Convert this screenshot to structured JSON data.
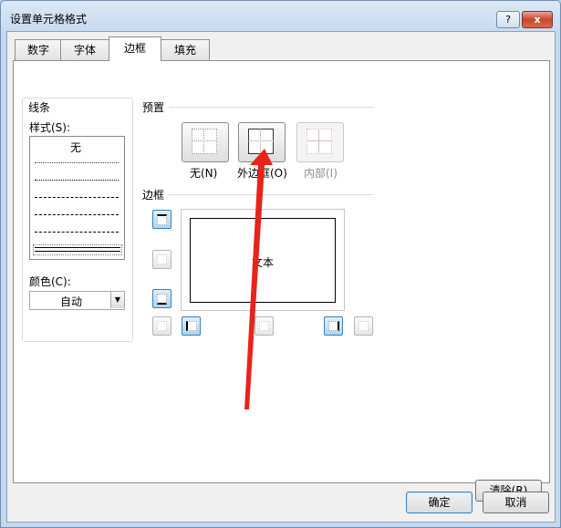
{
  "window": {
    "title": "设置单元格格式",
    "help_label": "?",
    "close_label": "x"
  },
  "tabs": [
    {
      "label": "数字"
    },
    {
      "label": "字体"
    },
    {
      "label": "边框",
      "active": true
    },
    {
      "label": "填充"
    }
  ],
  "line_group": {
    "title": "线条",
    "style_label": "样式(S):",
    "style_none": "无",
    "color_label": "颜色(C):",
    "color_value": "自动"
  },
  "presets": {
    "title": "预置",
    "items": [
      {
        "label": "无(N)",
        "enabled": true
      },
      {
        "label": "外边框(O)",
        "enabled": true
      },
      {
        "label": "内部(I)",
        "enabled": false
      }
    ]
  },
  "border": {
    "title": "边框",
    "preview_text": "文本"
  },
  "buttons": {
    "clear": "清除(R)",
    "ok": "确定",
    "cancel": "取消"
  },
  "colors": {
    "accent": "#3c7fb1",
    "arrow": "#e8231a"
  }
}
